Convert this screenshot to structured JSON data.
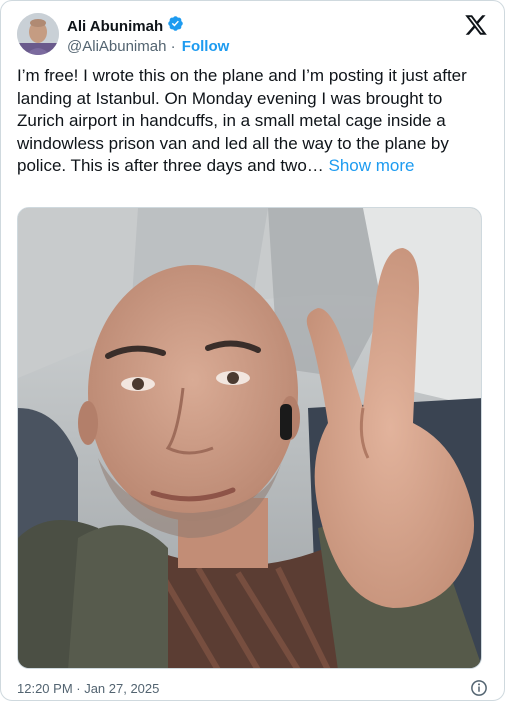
{
  "author": {
    "display_name": "Ali Abunimah",
    "handle": "@AliAbunimah",
    "separator": " · ",
    "follow_label": "Follow",
    "verified": true,
    "verified_color": "#1d9bf0"
  },
  "logo": "x-logo-icon",
  "post": {
    "text": "I’m free! I wrote this on the plane and I’m posting it just after landing at Istanbul. On Monday evening I was brought to Zurich airport in handcuffs, in a small metal cage inside a windowless prison van and led all the way to the plane by police. This is after three days and two…",
    "show_more_label": "Show more"
  },
  "footer": {
    "timestamp": "12:20 PM · Jan 27, 2025",
    "info_icon": "info-icon"
  },
  "colors": {
    "link": "#1d9bf0",
    "secondary_text": "#536471",
    "border": "#cfd9de"
  }
}
